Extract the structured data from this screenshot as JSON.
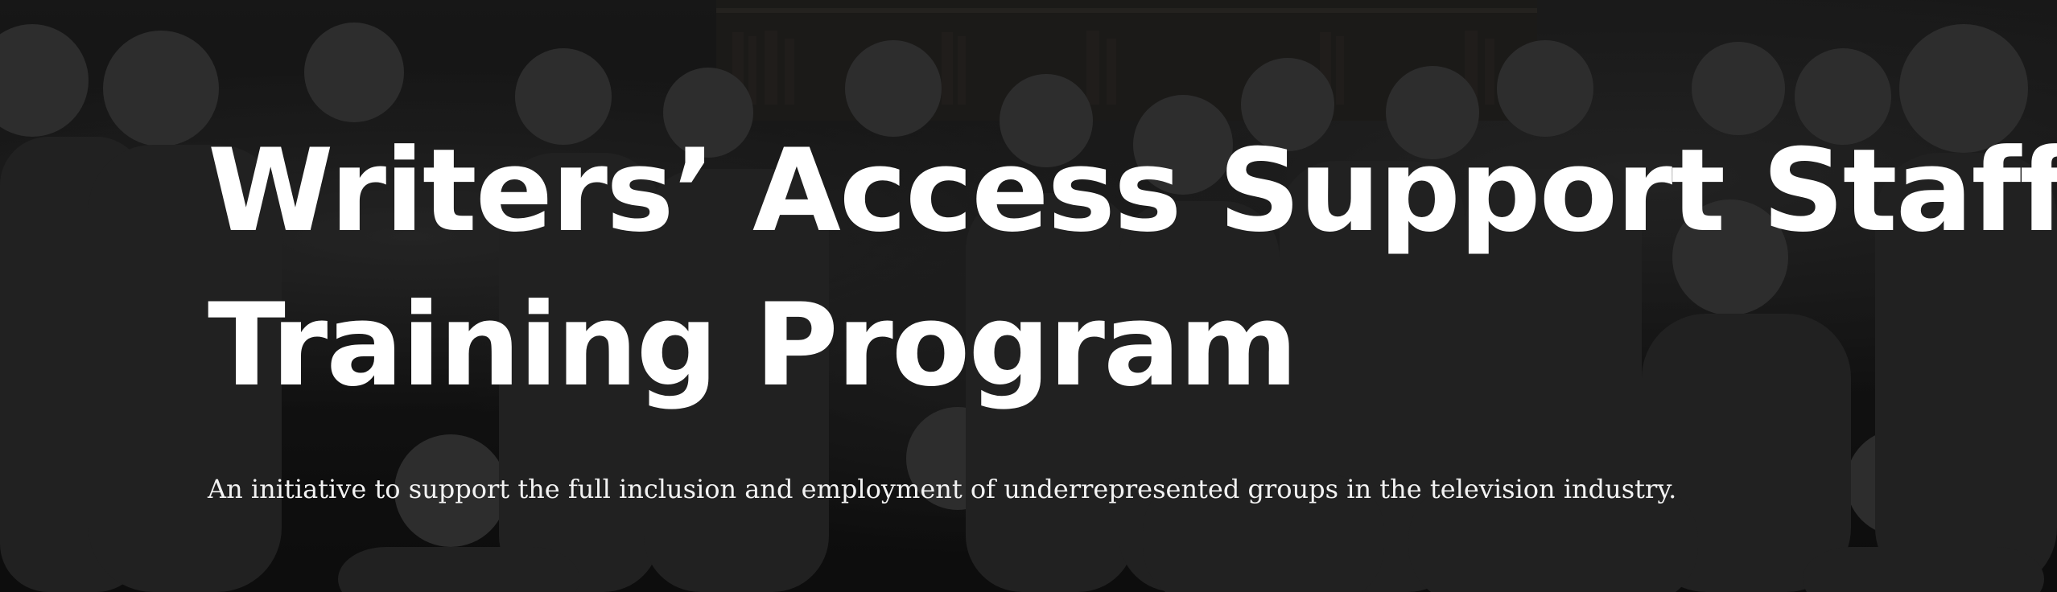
{
  "hero": {
    "title_line_1": "Writers’ Access Support Staff",
    "title_line_2": "Training Program",
    "subtitle": "An initiative to support the full inclusion and employment of underrepresented groups in the television industry."
  },
  "colors": {
    "text": "#ffffff",
    "overlay": "#000000"
  }
}
